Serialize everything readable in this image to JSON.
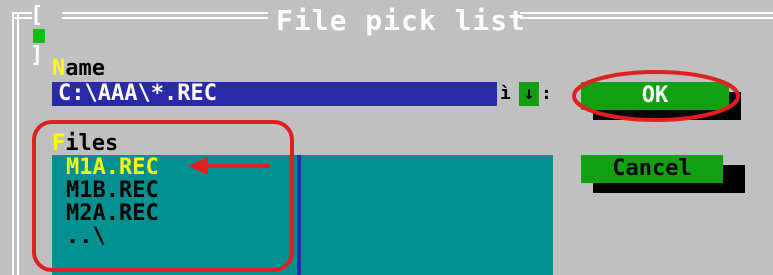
{
  "dialog": {
    "title": "File pick list",
    "close_box": "■"
  },
  "name_field": {
    "label_hot": "N",
    "label_rest": "ame",
    "value": "C:\\AAA\\*.REC",
    "tail": "ì",
    "dropdown_arrow": "↓",
    "arrow_tail": ":"
  },
  "buttons": {
    "ok_label": "OK",
    "cancel_label": "Cancel"
  },
  "files": {
    "label_hot": "F",
    "label_rest": "iles",
    "items": [
      "M1A.REC",
      "M1B.REC",
      "M2A.REC",
      "..\\"
    ],
    "selected_index": 0
  },
  "colors": {
    "background": "#c0c0c0",
    "input_bg": "#2a2aa8",
    "list_bg": "#009090",
    "button_bg": "#10a010",
    "hotkey": "#ffff00",
    "annotation": "#e02020"
  }
}
